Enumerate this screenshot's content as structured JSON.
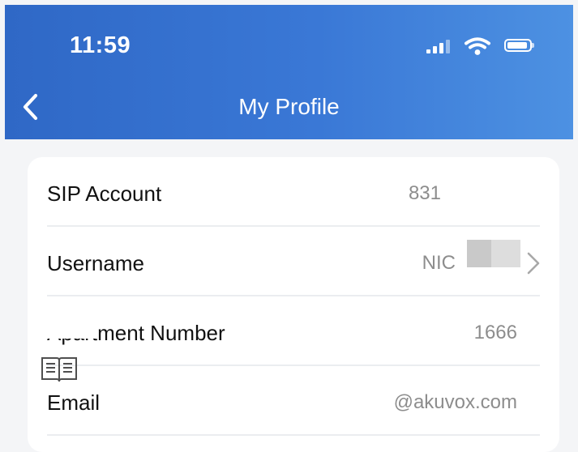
{
  "status_bar": {
    "time": "11:59"
  },
  "header": {
    "title": "My Profile",
    "back_icon": "chevron-left-icon"
  },
  "profile_rows": [
    {
      "label": "SIP Account",
      "value": "831"
    },
    {
      "label": "Username",
      "value": "NIC"
    },
    {
      "label": "Apartment Number",
      "value": "1666"
    },
    {
      "label": "Email",
      "value": "@akuvox.com"
    }
  ],
  "colors": {
    "header_start": "#2f68c6",
    "header_end": "#4d91e2",
    "value_text": "#8d8d8d",
    "divider": "#ebedf0"
  }
}
